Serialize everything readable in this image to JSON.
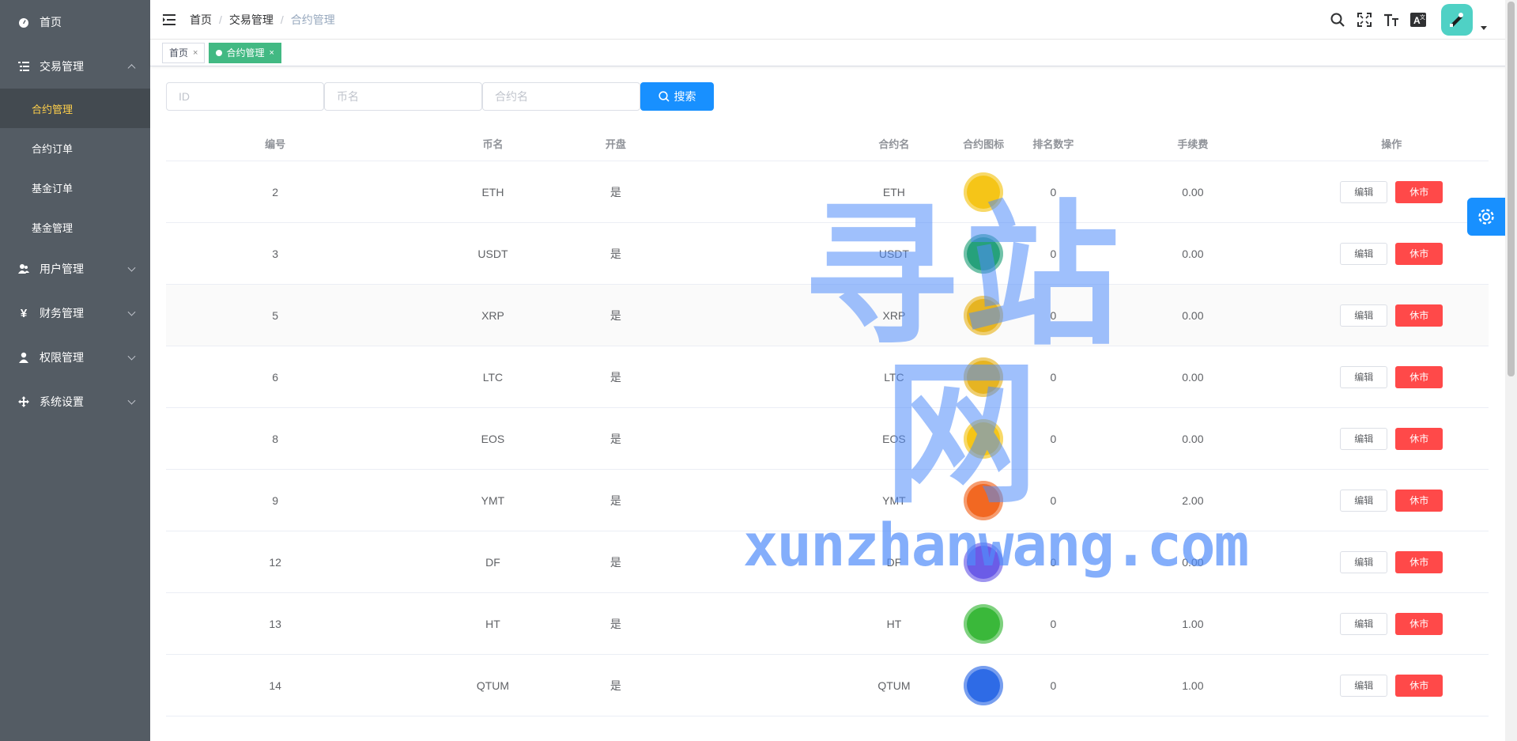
{
  "sidebar": {
    "items": [
      {
        "label": "首页",
        "icon": "dashboard-icon"
      },
      {
        "label": "交易管理",
        "icon": "list-icon",
        "expanded": true,
        "children": [
          {
            "label": "合约管理",
            "active": true
          },
          {
            "label": "合约订单"
          },
          {
            "label": "基金订单"
          },
          {
            "label": "基金管理"
          }
        ]
      },
      {
        "label": "用户管理",
        "icon": "users-icon"
      },
      {
        "label": "财务管理",
        "icon": "yen-icon"
      },
      {
        "label": "权限管理",
        "icon": "user-icon"
      },
      {
        "label": "系统设置",
        "icon": "move-icon"
      }
    ],
    "colors": {
      "bg": "#545c64",
      "active_text": "#ffd04b"
    }
  },
  "breadcrumb": [
    "首页",
    "交易管理",
    "合约管理"
  ],
  "tags": [
    {
      "label": "首页",
      "active": false
    },
    {
      "label": "合约管理",
      "active": true
    }
  ],
  "filters": {
    "id_placeholder": "ID",
    "coin_placeholder": "币名",
    "contract_placeholder": "合约名",
    "search_label": "搜索"
  },
  "table": {
    "headers": {
      "id": "编号",
      "coin": "币名",
      "open": "开盘",
      "contract": "合约名",
      "icon": "合约图标",
      "rank": "排名数字",
      "fee": "手续费",
      "ops": "操作"
    },
    "edit_label": "编辑",
    "off_label": "休市",
    "rows": [
      {
        "id": "2",
        "coin": "ETH",
        "open": "是",
        "contract": "ETH",
        "rank": "0",
        "fee": "0.00",
        "icon": "eth-coin-icon",
        "color": "#f5c518"
      },
      {
        "id": "3",
        "coin": "USDT",
        "open": "是",
        "contract": "USDT",
        "rank": "0",
        "fee": "0.00",
        "icon": "usdt-coin-icon",
        "color": "#26a17b"
      },
      {
        "id": "5",
        "coin": "XRP",
        "open": "是",
        "contract": "XRP",
        "rank": "0",
        "fee": "0.00",
        "icon": "xrp-coin-icon",
        "color": "#e6b422"
      },
      {
        "id": "6",
        "coin": "LTC",
        "open": "是",
        "contract": "LTC",
        "rank": "0",
        "fee": "0.00",
        "icon": "ltc-coin-icon",
        "color": "#e6b422"
      },
      {
        "id": "8",
        "coin": "EOS",
        "open": "是",
        "contract": "EOS",
        "rank": "0",
        "fee": "0.00",
        "icon": "eos-coin-icon",
        "color": "#f5c518"
      },
      {
        "id": "9",
        "coin": "YMT",
        "open": "是",
        "contract": "YMT",
        "rank": "0",
        "fee": "2.00",
        "icon": "monero-coin-icon",
        "color": "#f26822"
      },
      {
        "id": "12",
        "coin": "DF",
        "open": "是",
        "contract": "DF",
        "rank": "0",
        "fee": "0.00",
        "icon": "df-coin-icon",
        "color": "#6b5ce7"
      },
      {
        "id": "13",
        "coin": "HT",
        "open": "是",
        "contract": "HT",
        "rank": "0",
        "fee": "1.00",
        "icon": "etc-coin-icon",
        "color": "#3ab83a"
      },
      {
        "id": "14",
        "coin": "QTUM",
        "open": "是",
        "contract": "QTUM",
        "rank": "0",
        "fee": "1.00",
        "icon": "qtum-coin-icon",
        "color": "#2e6be6"
      }
    ]
  },
  "watermark": {
    "big": "寻站网",
    "small": "xunzhanwang.com"
  },
  "colors": {
    "primary": "#1890ff",
    "danger": "#ff4949",
    "tag_active": "#42b983"
  }
}
